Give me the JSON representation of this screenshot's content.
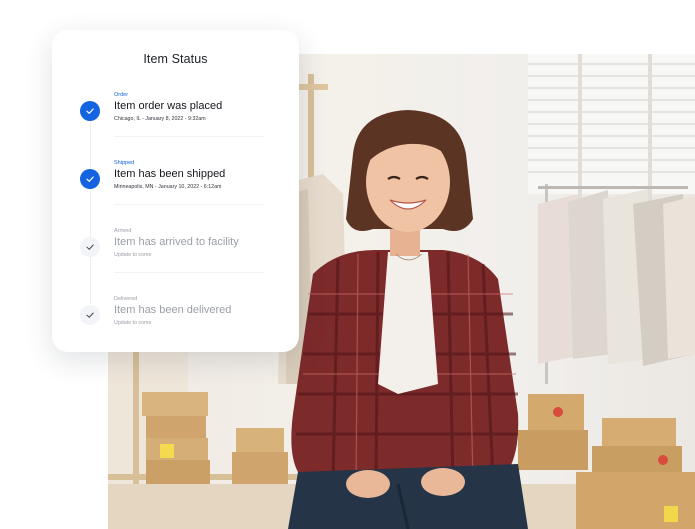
{
  "card": {
    "title": "Item Status",
    "steps": [
      {
        "tag": "Order",
        "heading": "Item order was placed",
        "meta": "Chicago, IL - January 8, 2022 - 9:32am",
        "state": "done",
        "icon": "check-icon"
      },
      {
        "tag": "Shipped",
        "heading": "Item has been shipped",
        "meta": "Minneapolis, MN - January 10, 2022 - 6:12am",
        "state": "done",
        "icon": "check-icon"
      },
      {
        "tag": "Arrived",
        "heading": "Item has arrived to facility",
        "meta": "Update to come",
        "state": "pending",
        "icon": "check-icon"
      },
      {
        "tag": "Delivered",
        "heading": "Item has been delivered",
        "meta": "Update to come",
        "state": "pending",
        "icon": "check-icon"
      }
    ]
  },
  "colors": {
    "accent": "#1463e0",
    "muted": "#9a9ea6",
    "heading": "#14171c"
  },
  "photo": {
    "subject": "smiling-woman-in-clothing-studio"
  }
}
